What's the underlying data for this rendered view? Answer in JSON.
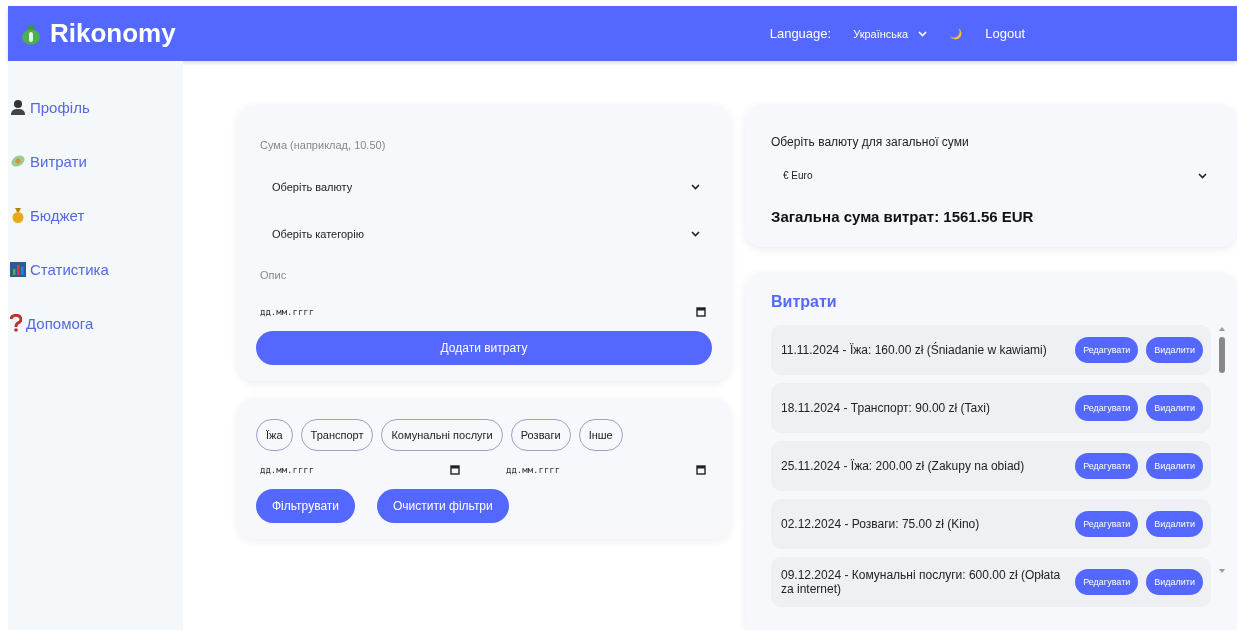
{
  "header": {
    "logo": "Rikonomy",
    "language_label": "Language:",
    "language": "Українська",
    "logout": "Logout"
  },
  "sidebar": {
    "items": [
      {
        "label": "Профіль",
        "kind": "profile"
      },
      {
        "label": "Витрати",
        "kind": "expenses"
      },
      {
        "label": "Бюджет",
        "kind": "budget"
      },
      {
        "label": "Статистика",
        "kind": "stats"
      },
      {
        "label": "Допомога",
        "kind": "help"
      }
    ]
  },
  "expense_form": {
    "amount_placeholder": "Сума (наприклад, 10.50)",
    "currency_placeholder": "Оберіть валюту",
    "category_placeholder": "Оберіть категорію",
    "description_placeholder": "Опис",
    "date_placeholder": "дд.мм.гггг",
    "submit": "Додати витрату"
  },
  "filters": {
    "categories": [
      "Їжа",
      "Транспорт",
      "Комунальні послуги",
      "Розваги",
      "Інше"
    ],
    "date_from": "дд.мм.гггг",
    "date_to": "дд.мм.гггг",
    "apply": "Фільтрувати",
    "clear": "Очистити фільтри"
  },
  "total": {
    "label": "Оберіть валюту для загальної суми",
    "currency": "€ Euro",
    "sum": "Загальна сума витрат: 1561.56 EUR"
  },
  "expenses": {
    "title": "Витрати",
    "items": [
      {
        "text": "11.11.2024 - Їжа: 160.00 zł (Śniadanie w kawiami)",
        "edit": "Редагувати",
        "delete": "Видалити"
      },
      {
        "text": "18.11.2024 - Транспорт: 90.00 zł (Taxi)",
        "edit": "Редагувати",
        "delete": "Видалити"
      },
      {
        "text": "25.11.2024 - Їжа: 200.00 zł (Zakupy na obiad)",
        "edit": "Редагувати",
        "delete": "Видалити"
      },
      {
        "text": "02.12.2024 - Розваги: 75.00 zł (Kino)",
        "edit": "Редагувати",
        "delete": "Видалити"
      },
      {
        "text": "09.12.2024 - Комунальні послуги: 600.00 zł (Opłata za internet)",
        "edit": "Редагувати",
        "delete": "Видалити"
      }
    ]
  }
}
